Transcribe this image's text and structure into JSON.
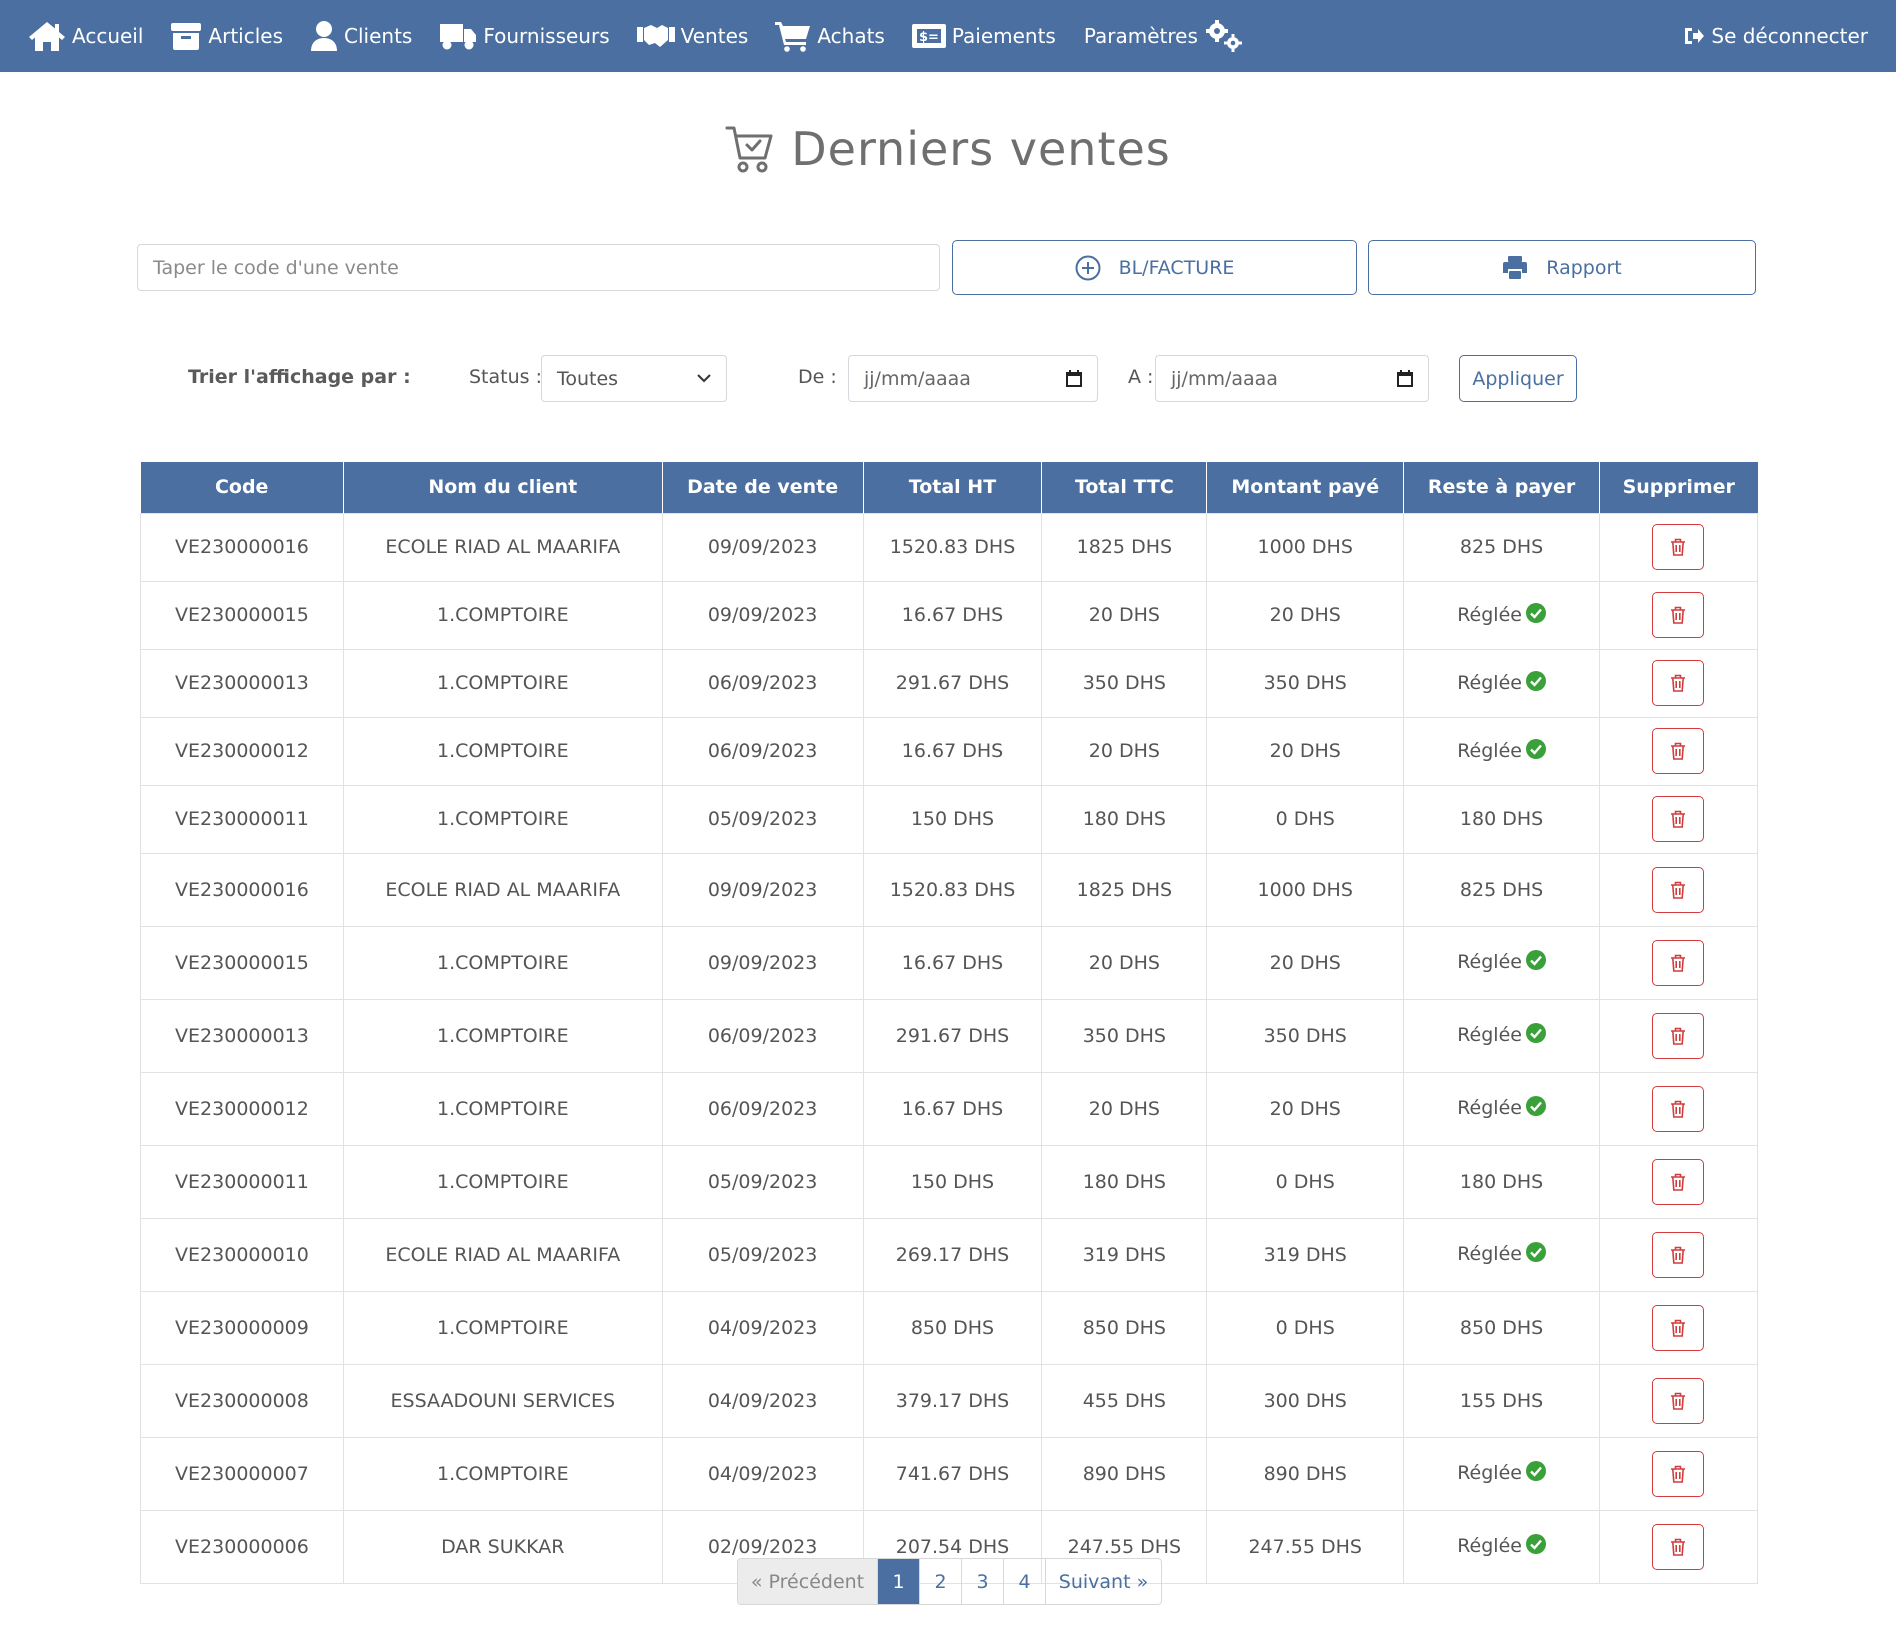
{
  "nav": {
    "items": [
      {
        "label": "Accueil",
        "icon": "home-icon"
      },
      {
        "label": "Articles",
        "icon": "box-icon"
      },
      {
        "label": "Clients",
        "icon": "user-icon"
      },
      {
        "label": "Fournisseurs",
        "icon": "truck-icon"
      },
      {
        "label": "Ventes",
        "icon": "handshake-icon"
      },
      {
        "label": "Achats",
        "icon": "cart-icon"
      },
      {
        "label": "Paiements",
        "icon": "money-icon"
      },
      {
        "label": "Paramètres",
        "icon": "gears-icon"
      }
    ],
    "logout": "Se déconnecter"
  },
  "page": {
    "title": "Derniers ventes"
  },
  "search": {
    "placeholder": "Taper le code d'une vente"
  },
  "actions": {
    "bl_facture": "BL/FACTURE",
    "rapport": "Rapport"
  },
  "filters": {
    "title": "Trier l'affichage par :",
    "status_label": "Status :",
    "status_value": "Toutes",
    "de_label": "De :",
    "de_placeholder": "jj/mm/aaaa",
    "a_label": "A :",
    "a_placeholder": "jj/mm/aaaa",
    "apply": "Appliquer"
  },
  "table": {
    "columns": [
      "Code",
      "Nom du client",
      "Date de vente",
      "Total HT",
      "Total TTC",
      "Montant payé",
      "Reste à payer",
      "Supprimer"
    ],
    "rows": [
      {
        "code": "VE230000016",
        "client": "ECOLE RIAD AL MAARIFA",
        "date": "09/09/2023",
        "ht": "1520.83 DHS",
        "ttc": "1825 DHS",
        "paye": "1000 DHS",
        "reste": "825 DHS",
        "reglee": false
      },
      {
        "code": "VE230000015",
        "client": "1.COMPTOIRE",
        "date": "09/09/2023",
        "ht": "16.67 DHS",
        "ttc": "20 DHS",
        "paye": "20 DHS",
        "reste": "Réglée",
        "reglee": true
      },
      {
        "code": "VE230000013",
        "client": "1.COMPTOIRE",
        "date": "06/09/2023",
        "ht": "291.67 DHS",
        "ttc": "350 DHS",
        "paye": "350 DHS",
        "reste": "Réglée",
        "reglee": true
      },
      {
        "code": "VE230000012",
        "client": "1.COMPTOIRE",
        "date": "06/09/2023",
        "ht": "16.67 DHS",
        "ttc": "20 DHS",
        "paye": "20 DHS",
        "reste": "Réglée",
        "reglee": true
      },
      {
        "code": "VE230000011",
        "client": "1.COMPTOIRE",
        "date": "05/09/2023",
        "ht": "150 DHS",
        "ttc": "180 DHS",
        "paye": "0 DHS",
        "reste": "180 DHS",
        "reglee": false
      },
      {
        "code": "VE230000016",
        "client": "ECOLE RIAD AL MAARIFA",
        "date": "09/09/2023",
        "ht": "1520.83 DHS",
        "ttc": "1825 DHS",
        "paye": "1000 DHS",
        "reste": "825 DHS",
        "reglee": false
      },
      {
        "code": "VE230000015",
        "client": "1.COMPTOIRE",
        "date": "09/09/2023",
        "ht": "16.67 DHS",
        "ttc": "20 DHS",
        "paye": "20 DHS",
        "reste": "Réglée",
        "reglee": true
      },
      {
        "code": "VE230000013",
        "client": "1.COMPTOIRE",
        "date": "06/09/2023",
        "ht": "291.67 DHS",
        "ttc": "350 DHS",
        "paye": "350 DHS",
        "reste": "Réglée",
        "reglee": true
      },
      {
        "code": "VE230000012",
        "client": "1.COMPTOIRE",
        "date": "06/09/2023",
        "ht": "16.67 DHS",
        "ttc": "20 DHS",
        "paye": "20 DHS",
        "reste": "Réglée",
        "reglee": true
      },
      {
        "code": "VE230000011",
        "client": "1.COMPTOIRE",
        "date": "05/09/2023",
        "ht": "150 DHS",
        "ttc": "180 DHS",
        "paye": "0 DHS",
        "reste": "180 DHS",
        "reglee": false
      },
      {
        "code": "VE230000010",
        "client": "ECOLE RIAD AL MAARIFA",
        "date": "05/09/2023",
        "ht": "269.17 DHS",
        "ttc": "319 DHS",
        "paye": "319 DHS",
        "reste": "Réglée",
        "reglee": true
      },
      {
        "code": "VE230000009",
        "client": "1.COMPTOIRE",
        "date": "04/09/2023",
        "ht": "850 DHS",
        "ttc": "850 DHS",
        "paye": "0 DHS",
        "reste": "850 DHS",
        "reglee": false
      },
      {
        "code": "VE230000008",
        "client": "ESSAADOUNI SERVICES",
        "date": "04/09/2023",
        "ht": "379.17 DHS",
        "ttc": "455 DHS",
        "paye": "300 DHS",
        "reste": "155 DHS",
        "reglee": false
      },
      {
        "code": "VE230000007",
        "client": "1.COMPTOIRE",
        "date": "04/09/2023",
        "ht": "741.67 DHS",
        "ttc": "890 DHS",
        "paye": "890 DHS",
        "reste": "Réglée",
        "reglee": true
      },
      {
        "code": "VE230000006",
        "client": "DAR SUKKAR",
        "date": "02/09/2023",
        "ht": "207.54 DHS",
        "ttc": "247.55 DHS",
        "paye": "247.55 DHS",
        "reste": "Réglée",
        "reglee": true
      }
    ]
  },
  "pagination": {
    "prev": "« Précédent",
    "pages": [
      "1",
      "2",
      "3",
      "4"
    ],
    "active": "1",
    "next": "Suivant »"
  },
  "colors": {
    "primary": "#4a6fa0",
    "success": "#3aa03a",
    "danger": "#d23c3c"
  }
}
